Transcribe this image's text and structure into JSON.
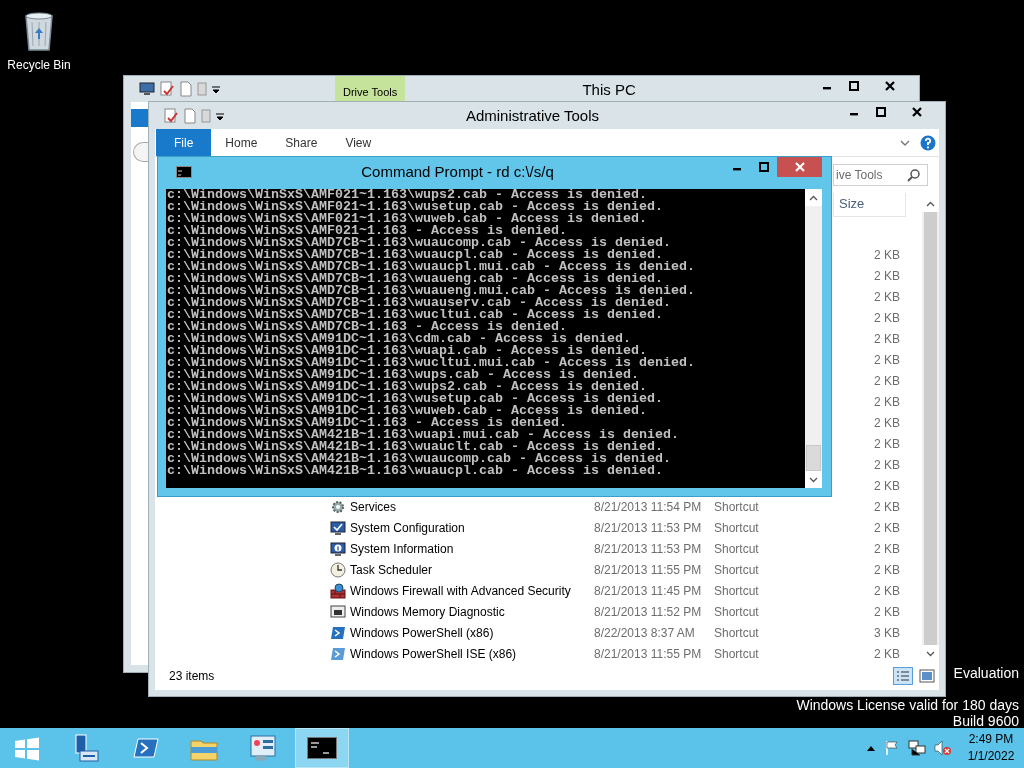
{
  "desktop": {
    "icons": [
      {
        "label": "Recycle Bin",
        "kind": "recycle-bin"
      }
    ],
    "notice": [
      "Evaluation",
      "Windows License valid for 180 days",
      "Build 9600"
    ]
  },
  "this_pc_window": {
    "title": "This PC",
    "contextual_tab": "Drive Tools"
  },
  "explorer_window": {
    "title": "Administrative Tools",
    "ribbon_tabs": [
      {
        "label": "File",
        "selected": true
      },
      {
        "label": "Home",
        "selected": false
      },
      {
        "label": "Share",
        "selected": false
      },
      {
        "label": "View",
        "selected": false
      }
    ],
    "search": {
      "placeholder": "ive Tools"
    },
    "columns": [
      "Size"
    ],
    "files": [
      {
        "size": "2 KB"
      },
      {
        "size": "2 KB"
      },
      {
        "size": "2 KB"
      },
      {
        "size": "2 KB"
      },
      {
        "size": "2 KB"
      },
      {
        "size": "2 KB"
      },
      {
        "size": "2 KB"
      },
      {
        "size": "2 KB"
      },
      {
        "size": "2 KB"
      },
      {
        "size": "2 KB"
      },
      {
        "size": "2 KB"
      },
      {
        "size": "2 KB"
      },
      {
        "kind": "services",
        "name": "Services",
        "date": "8/21/2013 11:54 PM",
        "type": "Shortcut",
        "size": "2 KB"
      },
      {
        "kind": "config",
        "name": "System Configuration",
        "date": "8/21/2013 11:53 PM",
        "type": "Shortcut",
        "size": "2 KB"
      },
      {
        "kind": "info",
        "name": "System Information",
        "date": "8/21/2013 11:53 PM",
        "type": "Shortcut",
        "size": "2 KB"
      },
      {
        "kind": "clock",
        "name": "Task Scheduler",
        "date": "8/21/2013 11:55 PM",
        "type": "Shortcut",
        "size": "2 KB"
      },
      {
        "kind": "firewall",
        "name": "Windows Firewall with Advanced Security",
        "date": "8/21/2013 11:45 PM",
        "type": "Shortcut",
        "size": "2 KB"
      },
      {
        "kind": "memory",
        "name": "Windows Memory Diagnostic",
        "date": "8/21/2013 11:52 PM",
        "type": "Shortcut",
        "size": "2 KB"
      },
      {
        "kind": "powershell",
        "name": "Windows PowerShell (x86)",
        "date": "8/22/2013 8:37 AM",
        "type": "Shortcut",
        "size": "3 KB"
      },
      {
        "kind": "powershell-ise",
        "name": "Windows PowerShell ISE (x86)",
        "date": "8/21/2013 11:55 PM",
        "type": "Shortcut",
        "size": "2 KB"
      }
    ],
    "status": "23 items"
  },
  "console_window": {
    "title": "Command Prompt - rd  c:\\/s/q",
    "lines": [
      "c:\\Windows\\WinSxS\\AMF021~1.163\\wups2.cab - Access is denied.",
      "c:\\Windows\\WinSxS\\AMF021~1.163\\wusetup.cab - Access is denied.",
      "c:\\Windows\\WinSxS\\AMF021~1.163\\wuweb.cab - Access is denied.",
      "c:\\Windows\\WinSxS\\AMF021~1.163 - Access is denied.",
      "c:\\Windows\\WinSxS\\AMD7CB~1.163\\wuaucomp.cab - Access is denied.",
      "c:\\Windows\\WinSxS\\AMD7CB~1.163\\wuaucpl.cab - Access is denied.",
      "c:\\Windows\\WinSxS\\AMD7CB~1.163\\wuaucpl.mui.cab - Access is denied.",
      "c:\\Windows\\WinSxS\\AMD7CB~1.163\\wuaueng.cab - Access is denied.",
      "c:\\Windows\\WinSxS\\AMD7CB~1.163\\wuaueng.mui.cab - Access is denied.",
      "c:\\Windows\\WinSxS\\AMD7CB~1.163\\wuauserv.cab - Access is denied.",
      "c:\\Windows\\WinSxS\\AMD7CB~1.163\\wucltui.cab - Access is denied.",
      "c:\\Windows\\WinSxS\\AMD7CB~1.163 - Access is denied.",
      "c:\\Windows\\WinSxS\\AM91DC~1.163\\cdm.cab - Access is denied.",
      "c:\\Windows\\WinSxS\\AM91DC~1.163\\wuapi.cab - Access is denied.",
      "c:\\Windows\\WinSxS\\AM91DC~1.163\\wucltui.mui.cab - Access is denied.",
      "c:\\Windows\\WinSxS\\AM91DC~1.163\\wups.cab - Access is denied.",
      "c:\\Windows\\WinSxS\\AM91DC~1.163\\wups2.cab - Access is denied.",
      "c:\\Windows\\WinSxS\\AM91DC~1.163\\wusetup.cab - Access is denied.",
      "c:\\Windows\\WinSxS\\AM91DC~1.163\\wuweb.cab - Access is denied.",
      "c:\\Windows\\WinSxS\\AM91DC~1.163 - Access is denied.",
      "c:\\Windows\\WinSxS\\AM421B~1.163\\wuapi.mui.cab - Access is denied.",
      "c:\\Windows\\WinSxS\\AM421B~1.163\\wuauclt.cab - Access is denied.",
      "c:\\Windows\\WinSxS\\AM421B~1.163\\wuaucomp.cab - Access is denied.",
      "c:\\Windows\\WinSxS\\AM421B~1.163\\wuaucpl.cab - Access is denied."
    ]
  },
  "taskbar": {
    "apps": [
      {
        "kind": "start",
        "active": false
      },
      {
        "kind": "server-manager",
        "active": false
      },
      {
        "kind": "powershell",
        "active": false
      },
      {
        "kind": "file-explorer",
        "active": false
      },
      {
        "kind": "admin-tools",
        "active": false
      },
      {
        "kind": "console",
        "active": true
      }
    ],
    "time": "2:49 PM",
    "date": "1/1/2022"
  }
}
